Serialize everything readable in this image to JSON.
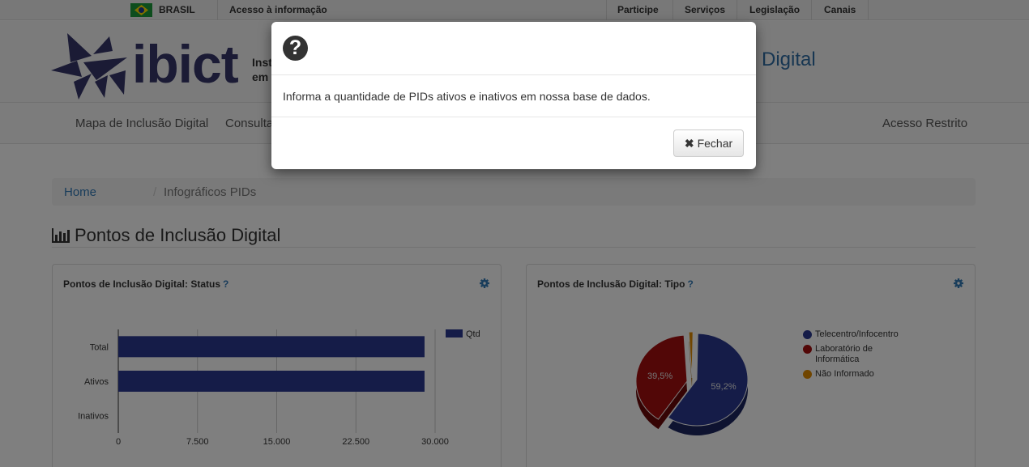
{
  "gov_bar": {
    "country": "BRASIL",
    "access_info": "Acesso à informação",
    "links": [
      "Participe",
      "Serviços",
      "Legislação",
      "Canais"
    ]
  },
  "header": {
    "logo_text": "ibict",
    "tagline_line1": "Inst",
    "tagline_line2": "em",
    "title_fragment": "o Digital"
  },
  "nav": {
    "items": [
      "Mapa de Inclusão Digital",
      "Consulta"
    ],
    "restricted": "Acesso Restrito"
  },
  "breadcrumb": {
    "home": "Home",
    "separator": "/",
    "current": "Infográficos PIDs"
  },
  "section": {
    "title": "Pontos de Inclusão Digital"
  },
  "panels": {
    "status": {
      "title": "Pontos de Inclusão Digital: Status",
      "help": "?"
    },
    "tipo": {
      "title": "Pontos de Inclusão Digital: Tipo",
      "help": "?"
    }
  },
  "chart_data": [
    {
      "type": "bar",
      "orientation": "horizontal",
      "categories": [
        "Total",
        "Ativos",
        "Inativos"
      ],
      "series": [
        {
          "name": "Qtd",
          "values": [
            29000,
            29000,
            0
          ]
        }
      ],
      "xlim": [
        0,
        30000
      ],
      "x_ticks": [
        "0",
        "7.500",
        "15.000",
        "22.500",
        "30.000"
      ],
      "grid": true,
      "legend": "right",
      "color": "#2b3990"
    },
    {
      "type": "pie",
      "labels": [
        "Telecentro/Infocentro",
        "Laboratório de Informática",
        "Não Informado"
      ],
      "values": [
        59.2,
        39.5,
        1.3
      ],
      "data_labels": [
        "59,2%",
        "39,5%",
        ""
      ],
      "colors": [
        "#2b3990",
        "#a50f0f",
        "#e08a00"
      ],
      "legend": "right"
    }
  ],
  "modal": {
    "icon": "question-circle-icon",
    "body": "Informa a quantidade de PIDs ativos e inativos em nossa base de dados.",
    "close_label": "Fechar"
  }
}
